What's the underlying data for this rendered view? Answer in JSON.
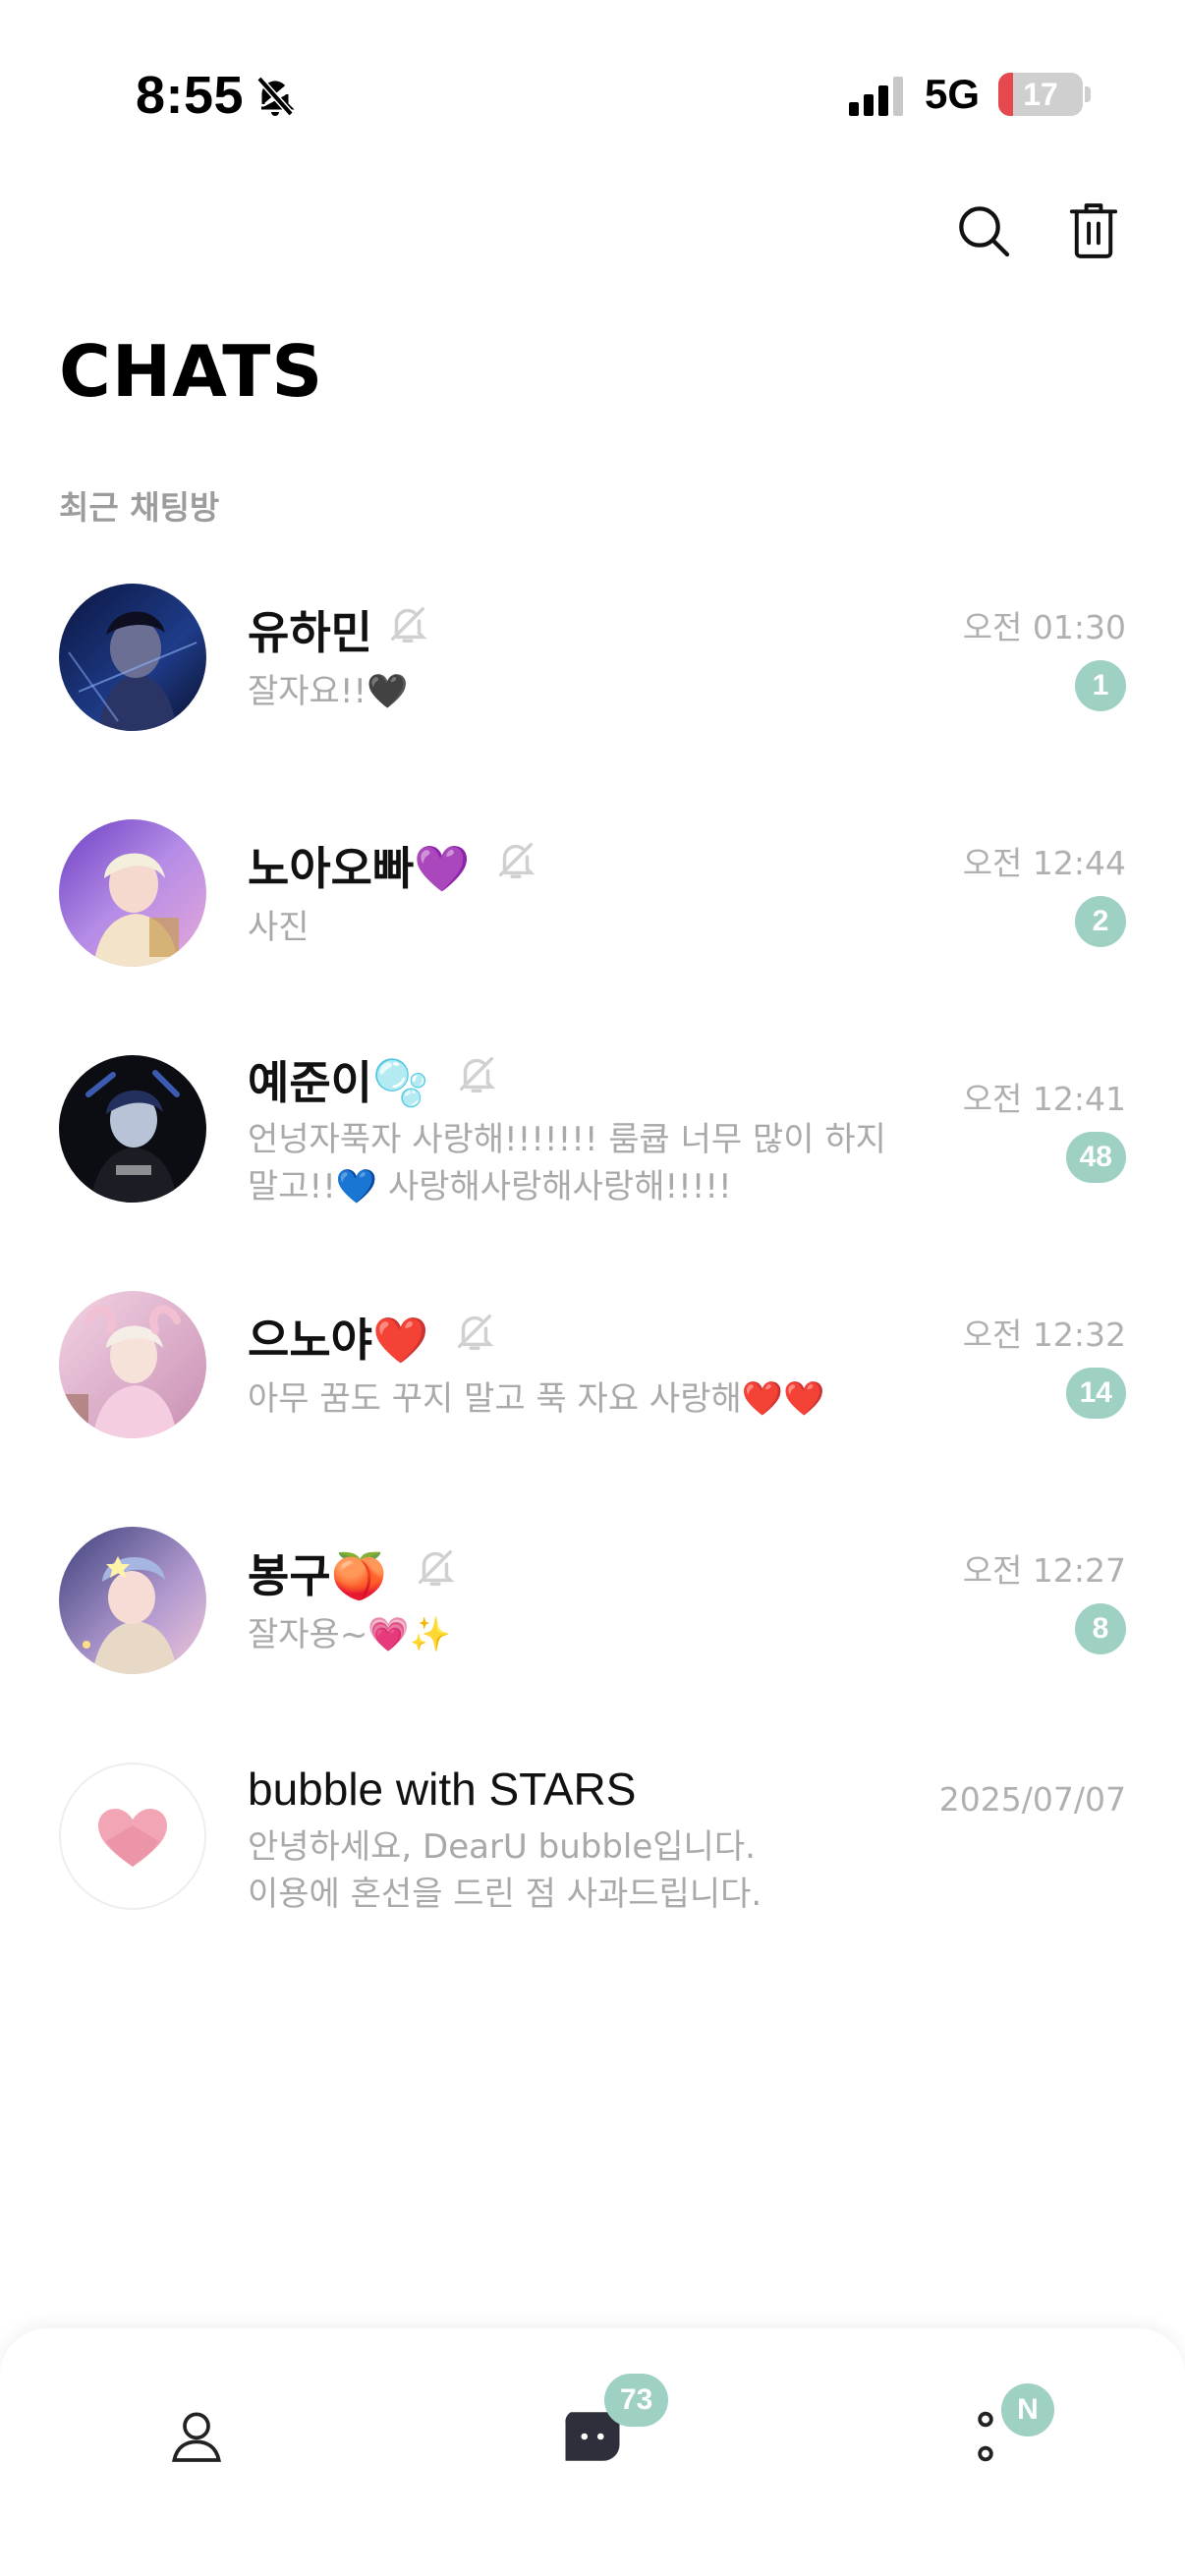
{
  "status_bar": {
    "time": "8:55",
    "network": "5G",
    "battery": "17",
    "battery_level": 0.17,
    "icons": [
      "bell-off-icon",
      "signal-icon",
      "battery-icon"
    ]
  },
  "header": {
    "title": "CHATS",
    "icons": [
      "search-icon",
      "trash-icon"
    ]
  },
  "section_label": "최근 채팅방",
  "chats": [
    {
      "name": "유하민",
      "muted": true,
      "preview": "잘자요!!🖤",
      "time": "오전 01:30",
      "unread": "1"
    },
    {
      "name": "노아오빠💜",
      "muted": true,
      "preview": "사진",
      "time": "오전 12:44",
      "unread": "2"
    },
    {
      "name": "예준이🫧",
      "muted": true,
      "preview": "언넝자푹자 사랑해!!!!!!! 룸큡 너무 많이 하지말고!!💙 사랑해사랑해사랑해!!!!!",
      "time": "오전 12:41",
      "unread": "48"
    },
    {
      "name": "으노야❤️",
      "muted": true,
      "preview": "아무 꿈도 꾸지 말고 푹 자요 사랑해❤️❤️",
      "time": "오전 12:32",
      "unread": "14"
    },
    {
      "name": "봉구🍑",
      "muted": true,
      "preview": "잘자용~💗✨",
      "time": "오전 12:27",
      "unread": "8"
    },
    {
      "name": "bubble with STARS",
      "muted": false,
      "preview_lines": [
        "안녕하세요, DearU bubble입니다.",
        "이용에 혼선을 드린 점 사과드립니다."
      ],
      "time": "2025/07/07"
    }
  ],
  "bottom_nav": {
    "items": [
      "profile-icon",
      "chat-icon",
      "more-icon"
    ],
    "chats_badge": "73",
    "more_badge": "N"
  },
  "colors": {
    "accent_badge": "#9fd0c4",
    "secondary_text": "#a9a9a9",
    "battery_low": "#e5484d"
  }
}
